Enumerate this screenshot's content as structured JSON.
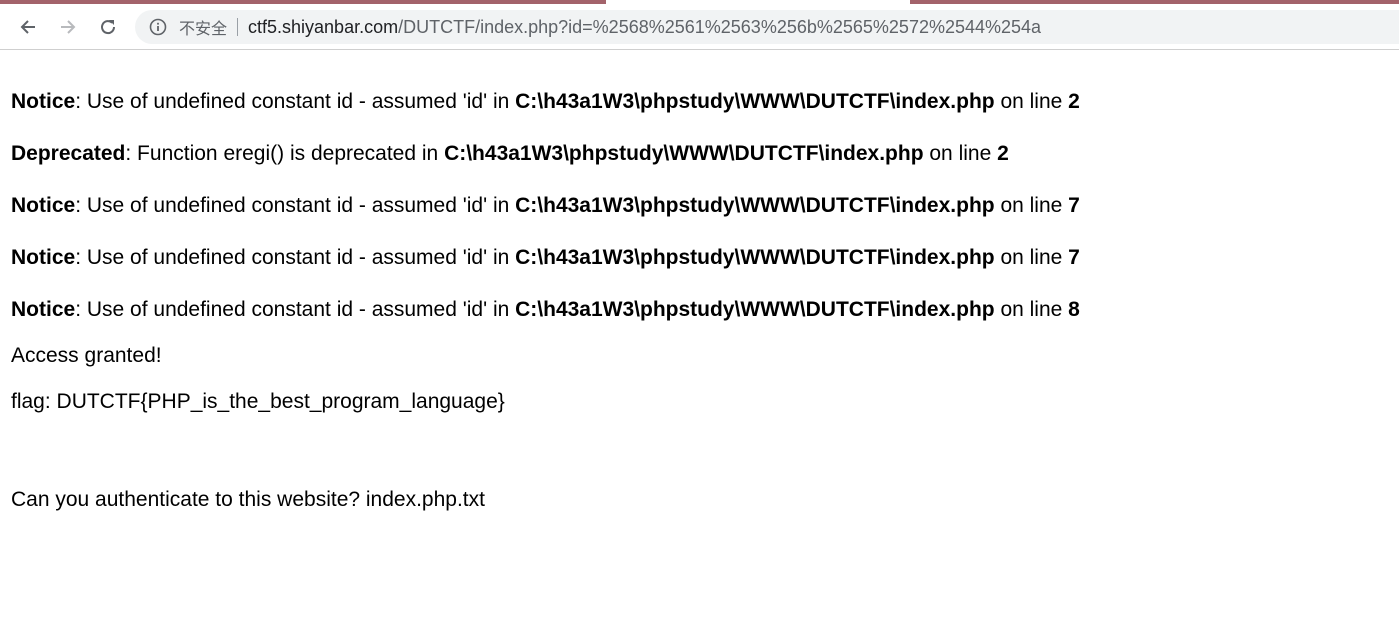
{
  "browser": {
    "security_label": "不安全",
    "url_host": "ctf5.shiyanbar.com",
    "url_path": "/DUTCTF/index.php?id=%2568%2561%2563%256b%2565%2572%2544%254a"
  },
  "errors": [
    {
      "type": "Notice",
      "message": ": Use of undefined constant id - assumed 'id' in ",
      "file": "C:\\h43a1W3\\phpstudy\\WWW\\DUTCTF\\index.php",
      "on_line": " on line ",
      "line": "2"
    },
    {
      "type": "Deprecated",
      "message": ": Function eregi() is deprecated in ",
      "file": "C:\\h43a1W3\\phpstudy\\WWW\\DUTCTF\\index.php",
      "on_line": " on line ",
      "line": "2"
    },
    {
      "type": "Notice",
      "message": ": Use of undefined constant id - assumed 'id' in ",
      "file": "C:\\h43a1W3\\phpstudy\\WWW\\DUTCTF\\index.php",
      "on_line": " on line ",
      "line": "7"
    },
    {
      "type": "Notice",
      "message": ": Use of undefined constant id - assumed 'id' in ",
      "file": "C:\\h43a1W3\\phpstudy\\WWW\\DUTCTF\\index.php",
      "on_line": " on line ",
      "line": "7"
    },
    {
      "type": "Notice",
      "message": ": Use of undefined constant id - assumed 'id' in ",
      "file": "C:\\h43a1W3\\phpstudy\\WWW\\DUTCTF\\index.php",
      "on_line": " on line ",
      "line": "8"
    }
  ],
  "access_text": "Access granted!",
  "flag_text": "flag: DUTCTF{PHP_is_the_best_program_language}",
  "question_text": "Can you authenticate to this website? index.php.txt"
}
